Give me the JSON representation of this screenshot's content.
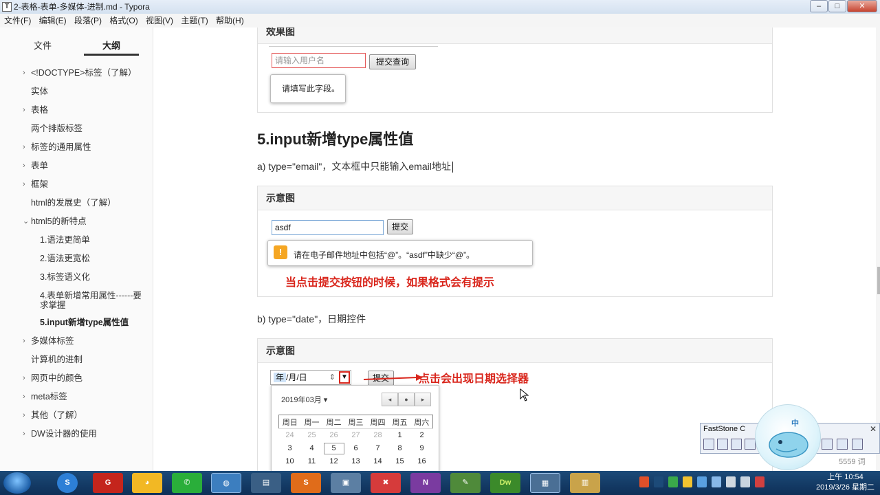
{
  "window": {
    "title": "2-表格-表单-多媒体-进制.md - Typora",
    "buttons": {
      "minimize": "–",
      "maximize": "□",
      "close": "✕"
    }
  },
  "menu": [
    "文件(F)",
    "编辑(E)",
    "段落(P)",
    "格式(O)",
    "视图(V)",
    "主题(T)",
    "帮助(H)"
  ],
  "sidebar": {
    "tabs": {
      "files": "文件",
      "outline": "大纲"
    },
    "items": [
      {
        "label": "<!DOCTYPE>标签（了解）",
        "chevron": "›"
      },
      {
        "label": "实体"
      },
      {
        "label": "表格",
        "chevron": "›"
      },
      {
        "label": "两个排版标签"
      },
      {
        "label": "标签的通用属性",
        "chevron": "›"
      },
      {
        "label": "表单",
        "chevron": "›"
      },
      {
        "label": "框架",
        "chevron": "›"
      },
      {
        "label": "html的发展史（了解）"
      },
      {
        "label": "html5的新特点",
        "chevron": "⌄"
      },
      {
        "label": "1.语法更简单"
      },
      {
        "label": "2.语法更宽松"
      },
      {
        "label": "3.标签语义化"
      },
      {
        "label": "4.表单新增常用属性------要求掌握"
      },
      {
        "label": "5.input新增type属性值"
      },
      {
        "label": "多媒体标签",
        "chevron": "›"
      },
      {
        "label": "计算机的进制"
      },
      {
        "label": "网页中的颜色",
        "chevron": "›"
      },
      {
        "label": "meta标签",
        "chevron": "›"
      },
      {
        "label": "其他（了解）",
        "chevron": "›"
      },
      {
        "label": "DW设计器的使用",
        "chevron": "›"
      }
    ],
    "footer_icons": {
      "back": "‹",
      "source": "</>"
    }
  },
  "content": {
    "panel1": {
      "header": "效果图",
      "input_placeholder": "请输入用户名",
      "submit": "提交查询",
      "tooltip": "请填写此字段。"
    },
    "heading": "5.input新增type属性值",
    "para_a": "a) type=\"email\"，文本框中只能输入email地址",
    "panel2": {
      "header": "示意图",
      "input_value": "asdf",
      "submit": "提交",
      "warning_icon": "!",
      "tooltip": "请在电子邮件地址中包括“@”。“asdf”中缺少“@”。",
      "note": "当点击提交按钮的时候，如果格式会有提示"
    },
    "para_b": "b) type=\"date\"，日期控件",
    "panel3": {
      "header": "示意图",
      "date_year": "年",
      "date_rest": "/月/日",
      "spin": "⇕",
      "dropdown": "▼",
      "submit": "提交",
      "note": "点击会出现日期选择器",
      "calendar": {
        "month": "2019年03月 ▾",
        "nav": [
          "◂",
          "●",
          "▸"
        ],
        "weekdays": [
          "周日",
          "周一",
          "周二",
          "周三",
          "周四",
          "周五",
          "周六"
        ],
        "rows": [
          [
            "24",
            "25",
            "26",
            "27",
            "28",
            "1",
            "2"
          ],
          [
            "3",
            "4",
            "5",
            "6",
            "7",
            "8",
            "9"
          ],
          [
            "10",
            "11",
            "12",
            "13",
            "14",
            "15",
            "16"
          ]
        ]
      }
    },
    "word_count": "5559 词"
  },
  "faststone": {
    "title": "FastStone C",
    "close": "✕"
  },
  "whale_label": "中",
  "taskbar": {
    "apps": [
      "S",
      "G",
      "◕",
      "✆",
      "◍",
      "▤",
      "S",
      "▣",
      "✖",
      "N",
      "✎",
      "Dw",
      "▦",
      "▥"
    ],
    "time": "上午 10:54",
    "date": "2019/3/26 星期二"
  }
}
